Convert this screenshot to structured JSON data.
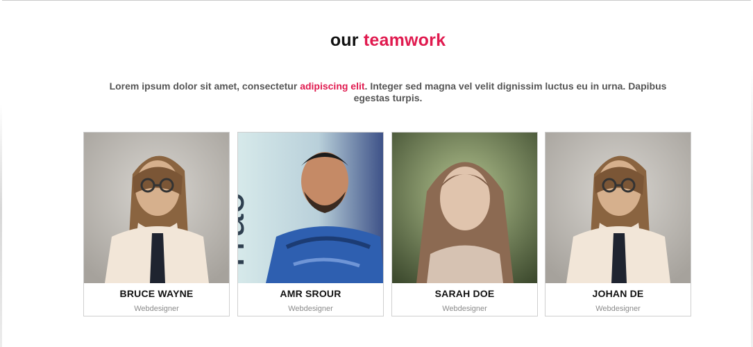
{
  "section": {
    "title_part1": "our",
    "title_part2": "teamwork",
    "intro_part1": "Lorem ipsum dolor sit amet, consectetur ",
    "intro_accent": "adipiscing elit",
    "intro_part2": ". Integer sed magna vel velit dignissim luctus eu in urna. Dapibus egestas turpis."
  },
  "colors": {
    "accent": "#e01a4f",
    "text_dark": "#111111",
    "text_body": "#555555",
    "text_muted": "#8b8b8b",
    "border": "#cfcfcf"
  },
  "team": [
    {
      "name": "BRUCE WAYNE",
      "role": "Webdesigner"
    },
    {
      "name": "AMR SROUR",
      "role": "Webdesigner"
    },
    {
      "name": "SARAH DOE",
      "role": "Webdesigner"
    },
    {
      "name": "JOHAN DE",
      "role": "Webdesigner"
    }
  ]
}
